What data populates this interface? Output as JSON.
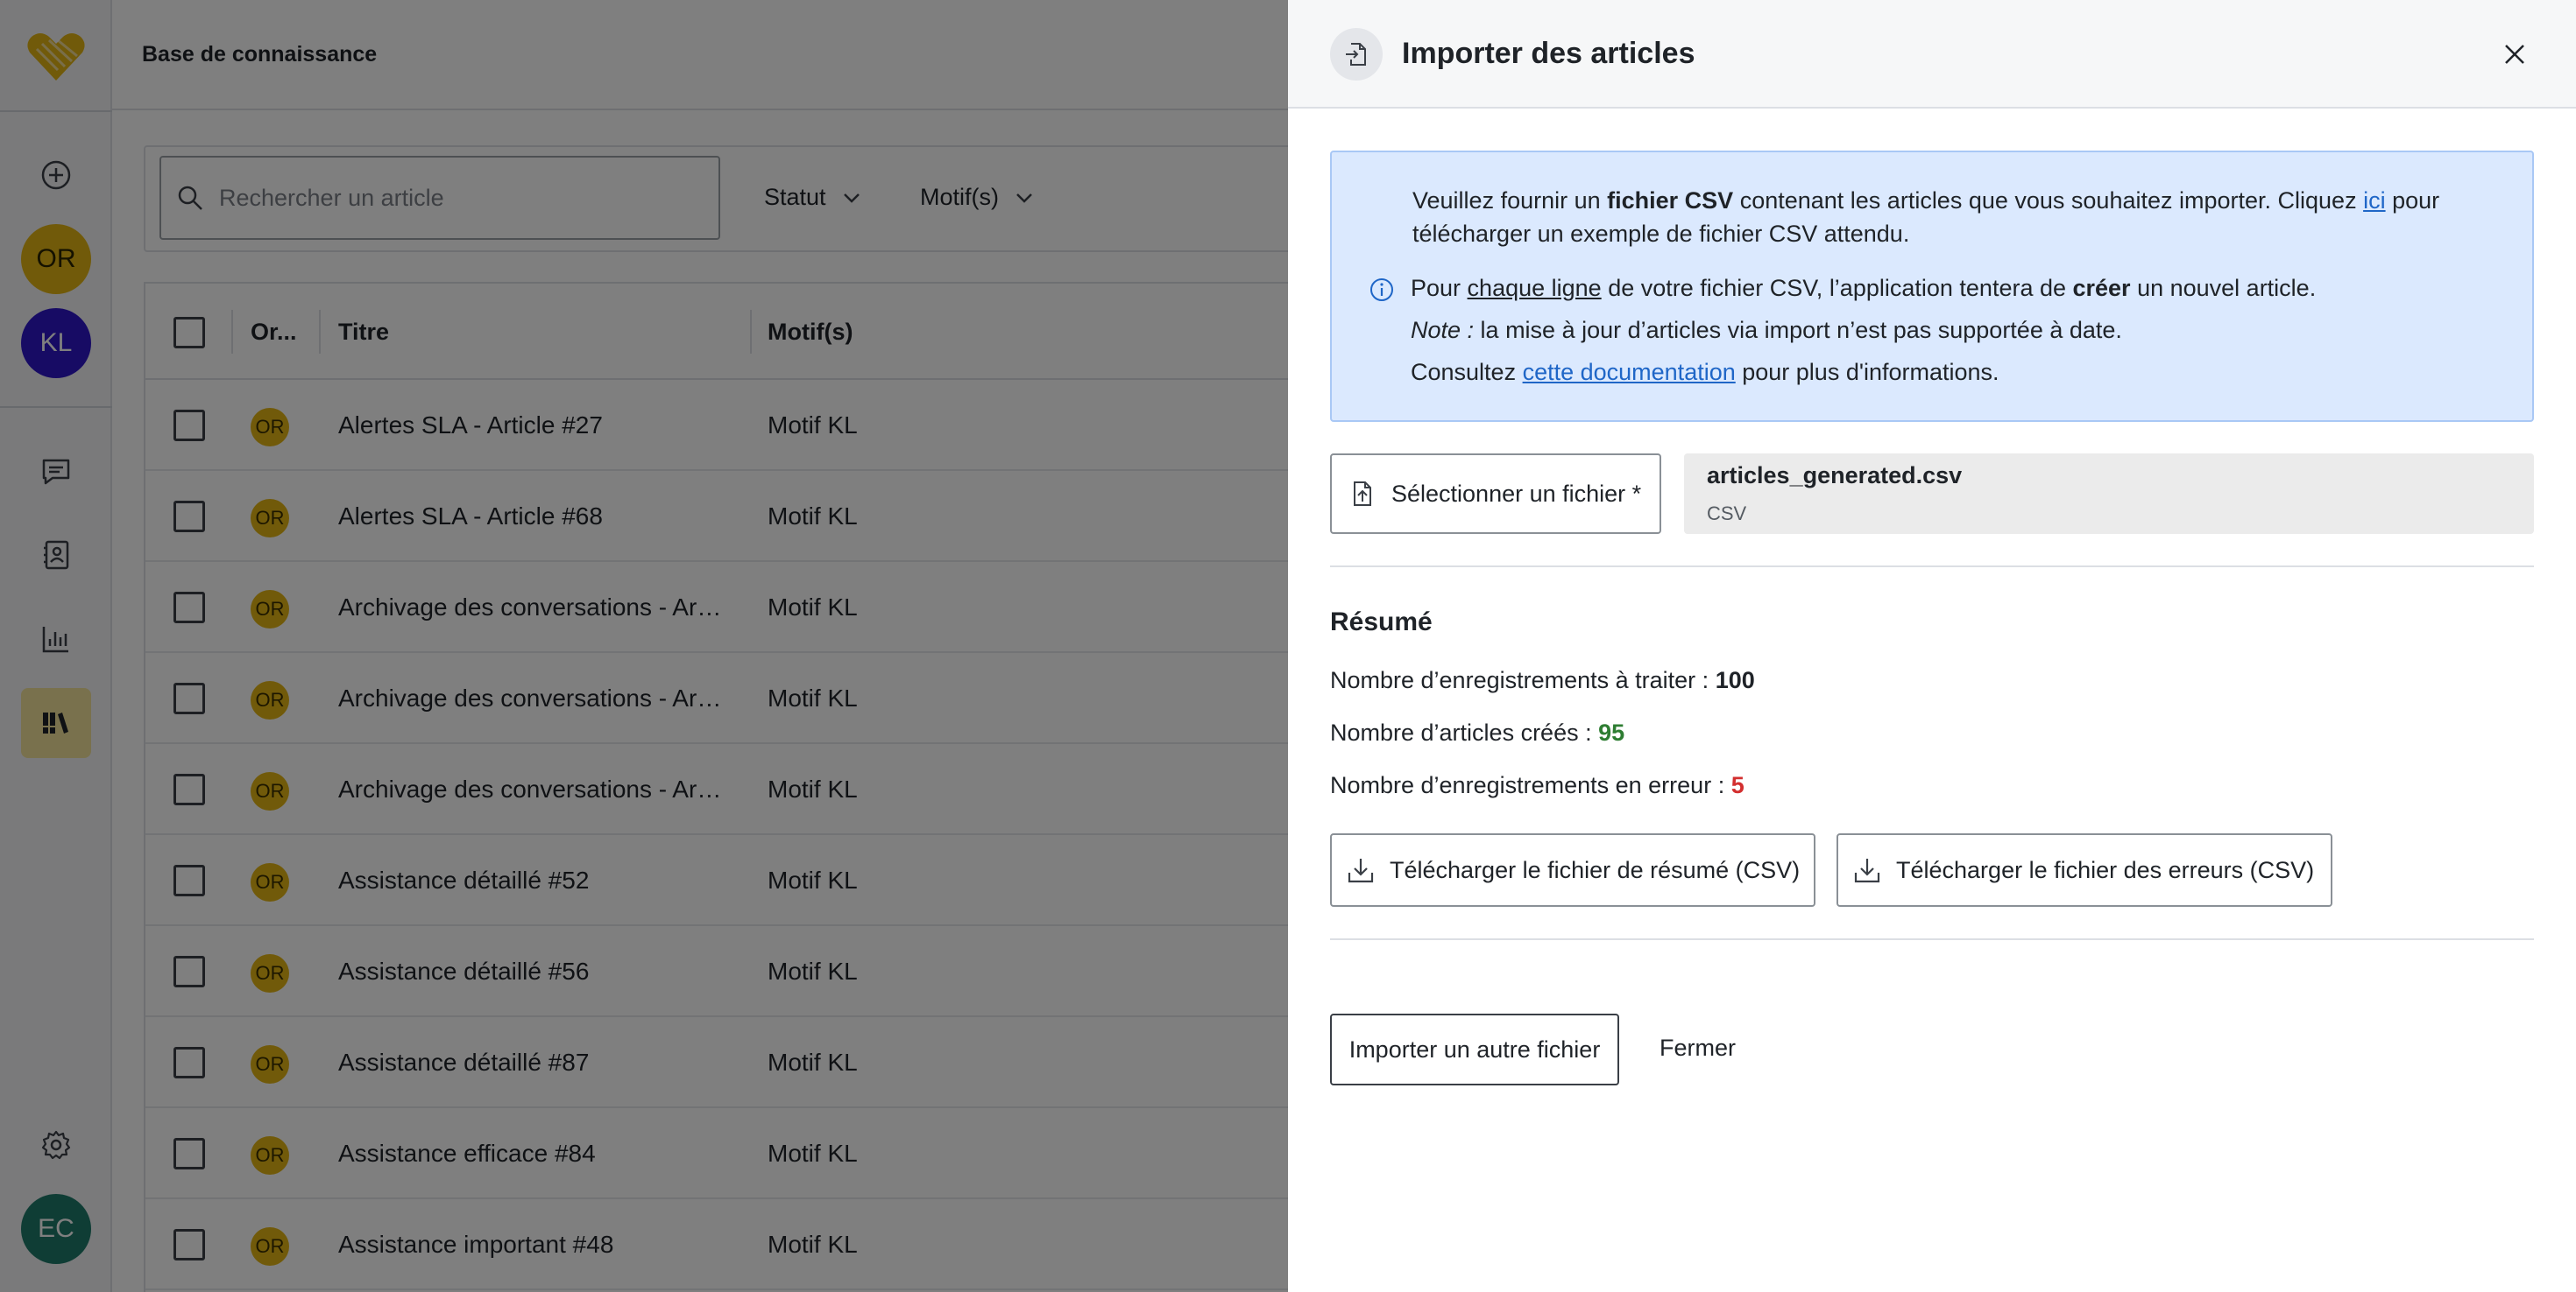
{
  "app": {
    "page_title": "Base de connaissance",
    "sidebar": {
      "avatars": [
        {
          "initials": "OR",
          "color": "#e3b514",
          "text_color": "#2b2400"
        },
        {
          "initials": "KL",
          "color": "#2f17c9",
          "text_color": "#ffffff"
        }
      ],
      "user_avatar": {
        "initials": "EC",
        "color": "#1f7a6a"
      },
      "active_accent": "#f3e39a"
    },
    "search": {
      "placeholder": "Rechercher un article"
    },
    "filters": {
      "status": "Statut",
      "motifs": "Motif(s)"
    },
    "table": {
      "headers": {
        "origin": "Or...",
        "title": "Titre",
        "motif": "Motif(s)"
      },
      "rows": [
        {
          "origin": "OR",
          "title": "Alertes SLA - Article #27",
          "motif": "Motif KL"
        },
        {
          "origin": "OR",
          "title": "Alertes SLA - Article #68",
          "motif": "Motif KL"
        },
        {
          "origin": "OR",
          "title": "Archivage des conversations - Arti...",
          "motif": "Motif KL"
        },
        {
          "origin": "OR",
          "title": "Archivage des conversations - Arti...",
          "motif": "Motif KL"
        },
        {
          "origin": "OR",
          "title": "Archivage des conversations - Arti...",
          "motif": "Motif KL"
        },
        {
          "origin": "OR",
          "title": "Assistance détaillé #52",
          "motif": "Motif KL"
        },
        {
          "origin": "OR",
          "title": "Assistance détaillé #56",
          "motif": "Motif KL"
        },
        {
          "origin": "OR",
          "title": "Assistance détaillé #87",
          "motif": "Motif KL"
        },
        {
          "origin": "OR",
          "title": "Assistance efficace #84",
          "motif": "Motif KL"
        },
        {
          "origin": "OR",
          "title": "Assistance important #48",
          "motif": "Motif KL"
        }
      ]
    }
  },
  "drawer": {
    "title": "Importer des articles",
    "info": {
      "l1_a": "Veuillez fournir un ",
      "l1_b": "fichier CSV",
      "l1_c": " contenant les articles que vous souhaitez importer. Cliquez ",
      "l1_link": "ici",
      "l1_d": " pour",
      "l2": "télécharger un exemple de fichier CSV attendu.",
      "l3_a": "Pour ",
      "l3_b": "chaque ligne",
      "l3_c": " de votre fichier CSV, l’application tentera de ",
      "l3_d": "créer",
      "l3_e": " un nouvel article.",
      "l4_a": "Note :",
      "l4_b": " la mise à jour d’articles via import n’est pas supportée à date.",
      "l5_a": "Consultez ",
      "l5_link": "cette documentation",
      "l5_b": " pour plus d'informations."
    },
    "file": {
      "select_label": "Sélectionner un fichier *",
      "name": "articles_generated.csv",
      "type": "CSV"
    },
    "summary": {
      "title": "Résumé",
      "records_label": "Nombre d’enregistrements à traiter : ",
      "records_value": "100",
      "created_label": "Nombre d’articles créés : ",
      "created_value": "95",
      "errors_label": "Nombre d’enregistrements en erreur : ",
      "errors_value": "5"
    },
    "buttons": {
      "download_summary": "Télécharger le fichier de résumé (CSV)",
      "download_errors": "Télécharger le fichier des erreurs (CSV)",
      "import_another": "Importer un autre fichier",
      "close": "Fermer"
    }
  }
}
